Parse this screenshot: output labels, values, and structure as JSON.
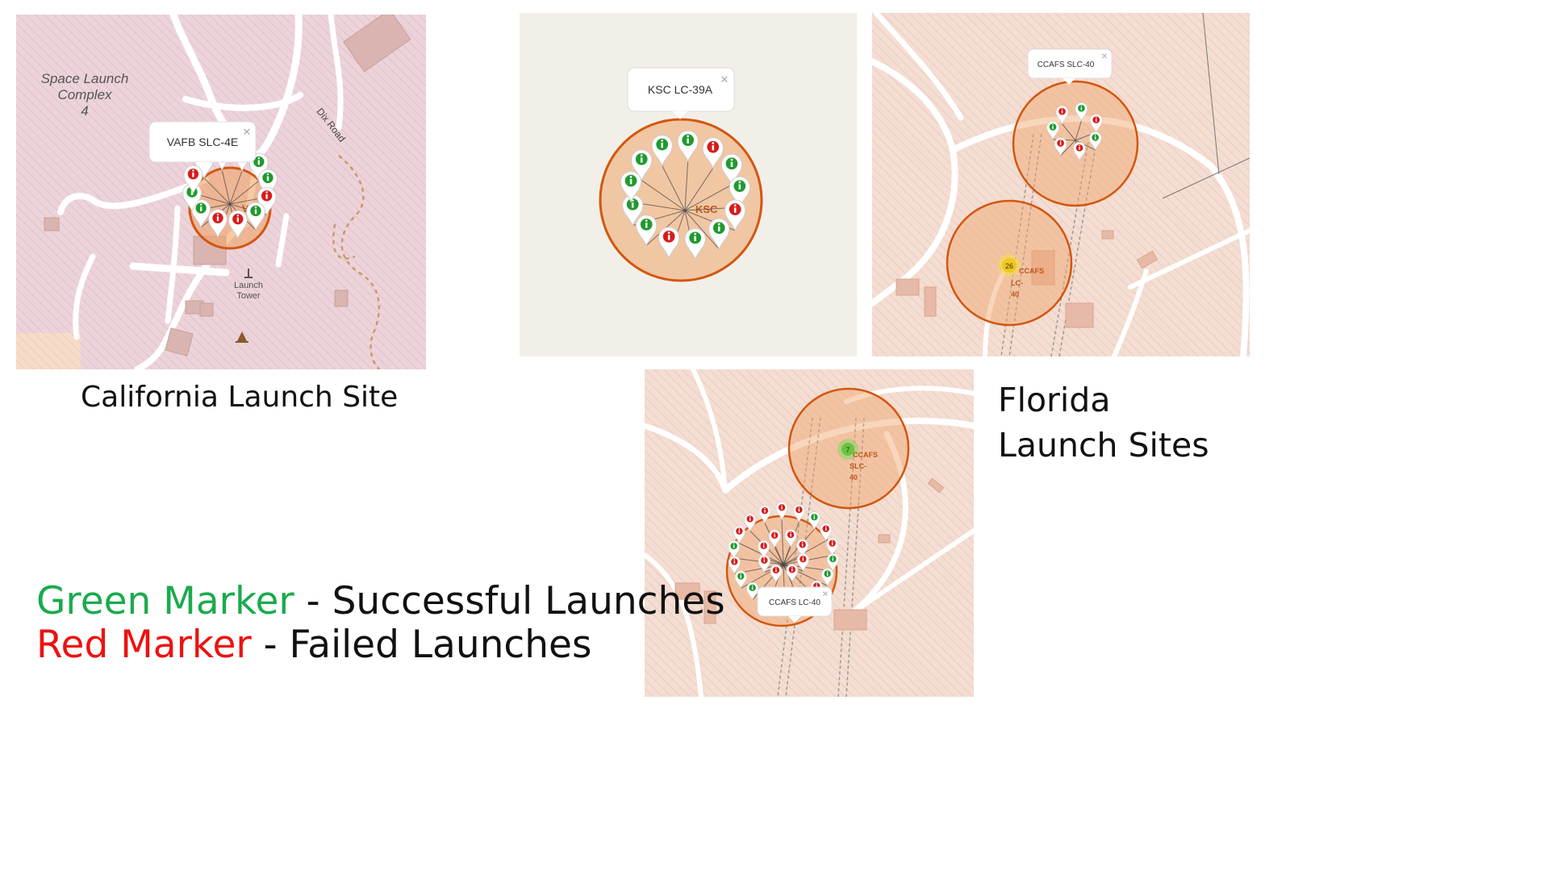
{
  "colors": {
    "success": "#1f9a2e",
    "failure": "#d81b1b",
    "circle_stroke": "#d2570f",
    "circle_fill": "#f0a468",
    "legend_green": "#1aab4d",
    "legend_red": "#ee1111"
  },
  "panels": {
    "california": {
      "popup": "VAFB SLC-4E",
      "site_label": "VAFB",
      "map_labels": {
        "complex": [
          "Space Launch",
          "Complex",
          "4"
        ],
        "road": "Dix Road",
        "tower": [
          "Launch",
          "Tower"
        ]
      },
      "markers": {
        "success": 5,
        "failure": 7
      }
    },
    "ksc": {
      "popup": "KSC LC-39A",
      "site_label": "KSC",
      "markers": {
        "success": 10,
        "failure": 3
      }
    },
    "ccafs_top": {
      "popup": "CCAFS SLC-40",
      "cluster_count": "26",
      "lc40_label": [
        "CCAFS",
        "LC-",
        "40"
      ],
      "markers": {
        "success": 3,
        "failure": 4
      }
    },
    "ccafs_bottom": {
      "popup": "CCAFS LC-40",
      "cluster_count": "7",
      "slc40_label": [
        "CCAFS",
        "SLC-",
        "40"
      ],
      "markers": {
        "success": 7,
        "failure": 19
      }
    }
  },
  "captions": {
    "california": "California Launch Site",
    "florida": [
      "Florida",
      "Launch Sites"
    ]
  },
  "legend": [
    {
      "color_word": "Green Marker",
      "rest": " - Successful Launches"
    },
    {
      "color_word": "Red Marker",
      "rest": " - Failed Launches"
    }
  ],
  "icons": {
    "marker": "map-pin-icon",
    "info": "info-icon",
    "close": "close-icon",
    "tower": "launch-tower-icon",
    "campsite": "campsite-icon"
  }
}
